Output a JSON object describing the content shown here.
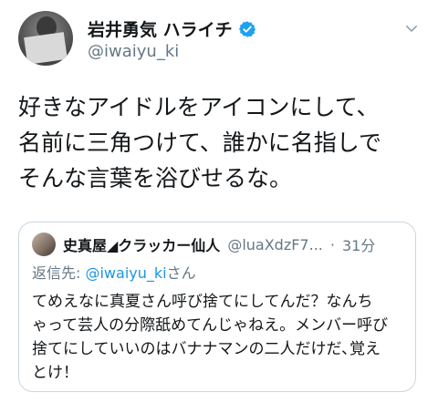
{
  "author": {
    "display_name": "岩井勇気 ハライチ",
    "handle": "@iwaiyu_ki",
    "avatar_icon": "user-avatar-photo",
    "verified_icon": "verified-badge-icon"
  },
  "menu": {
    "icon": "chevron-down-icon"
  },
  "tweet": {
    "lines": [
      "好きなアイドルをアイコンにして、",
      "名前に三角つけて、誰かに名指しで",
      "そんな言葉を浴びせるな。"
    ]
  },
  "quoted": {
    "display_name": "史真屋◢クラッカー仙人",
    "handle": "@luaXdzF7...",
    "separator": "·",
    "time": "31分",
    "reply_prefix": "返信先: ",
    "reply_to": "@iwaiyu_ki",
    "reply_suffix": "さん",
    "lines": [
      "てめえなに真夏さん呼び捨てにしてんだ？なんち",
      "ゃって芸人の分際舐めてんじゃねえ。メンバー呼び",
      "捨てにしていいのはバナナマンの二人だけだ､覚え",
      "とけ！"
    ]
  },
  "colors": {
    "text": "#14171a",
    "secondary": "#657786",
    "link": "#1b95e0",
    "verified": "#1da1f2",
    "border": "#ccd6dd"
  }
}
